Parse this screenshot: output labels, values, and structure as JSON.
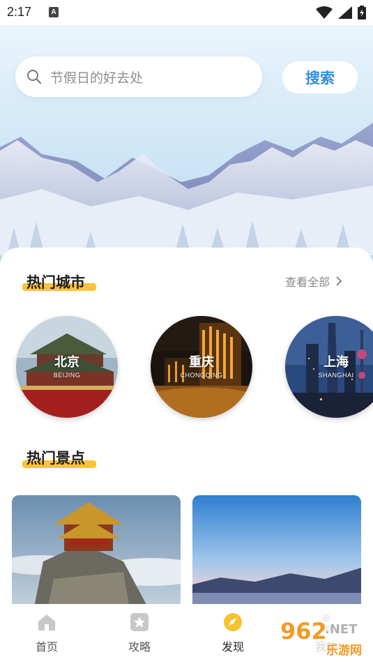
{
  "status_bar": {
    "time": "2:17",
    "notification_glyph": "A"
  },
  "search": {
    "placeholder": "节假日的好去处",
    "button_label": "搜索"
  },
  "hot_cities": {
    "title": "热门城市",
    "view_all_label": "查看全部",
    "cities": [
      {
        "name": "北京",
        "en": "BEIJING"
      },
      {
        "name": "重庆",
        "en": "CHONGQING"
      },
      {
        "name": "上海",
        "en": "SHANGHAI"
      }
    ]
  },
  "hot_spots": {
    "title": "热门景点"
  },
  "tabbar": {
    "items": [
      {
        "label": "首页",
        "icon": "home-icon"
      },
      {
        "label": "攻略",
        "icon": "star-icon"
      },
      {
        "label": "发现",
        "icon": "compass-icon"
      },
      {
        "label": "我的",
        "icon": "user-icon"
      }
    ],
    "active_index": 2
  },
  "watermark": {
    "brand": "962",
    "suffix": ".NET",
    "caption": "乐游网"
  },
  "colors": {
    "accent_blue": "#2f8fe0",
    "highlight_yellow": "#f9c33a",
    "active_tab": "#f7c22f"
  }
}
